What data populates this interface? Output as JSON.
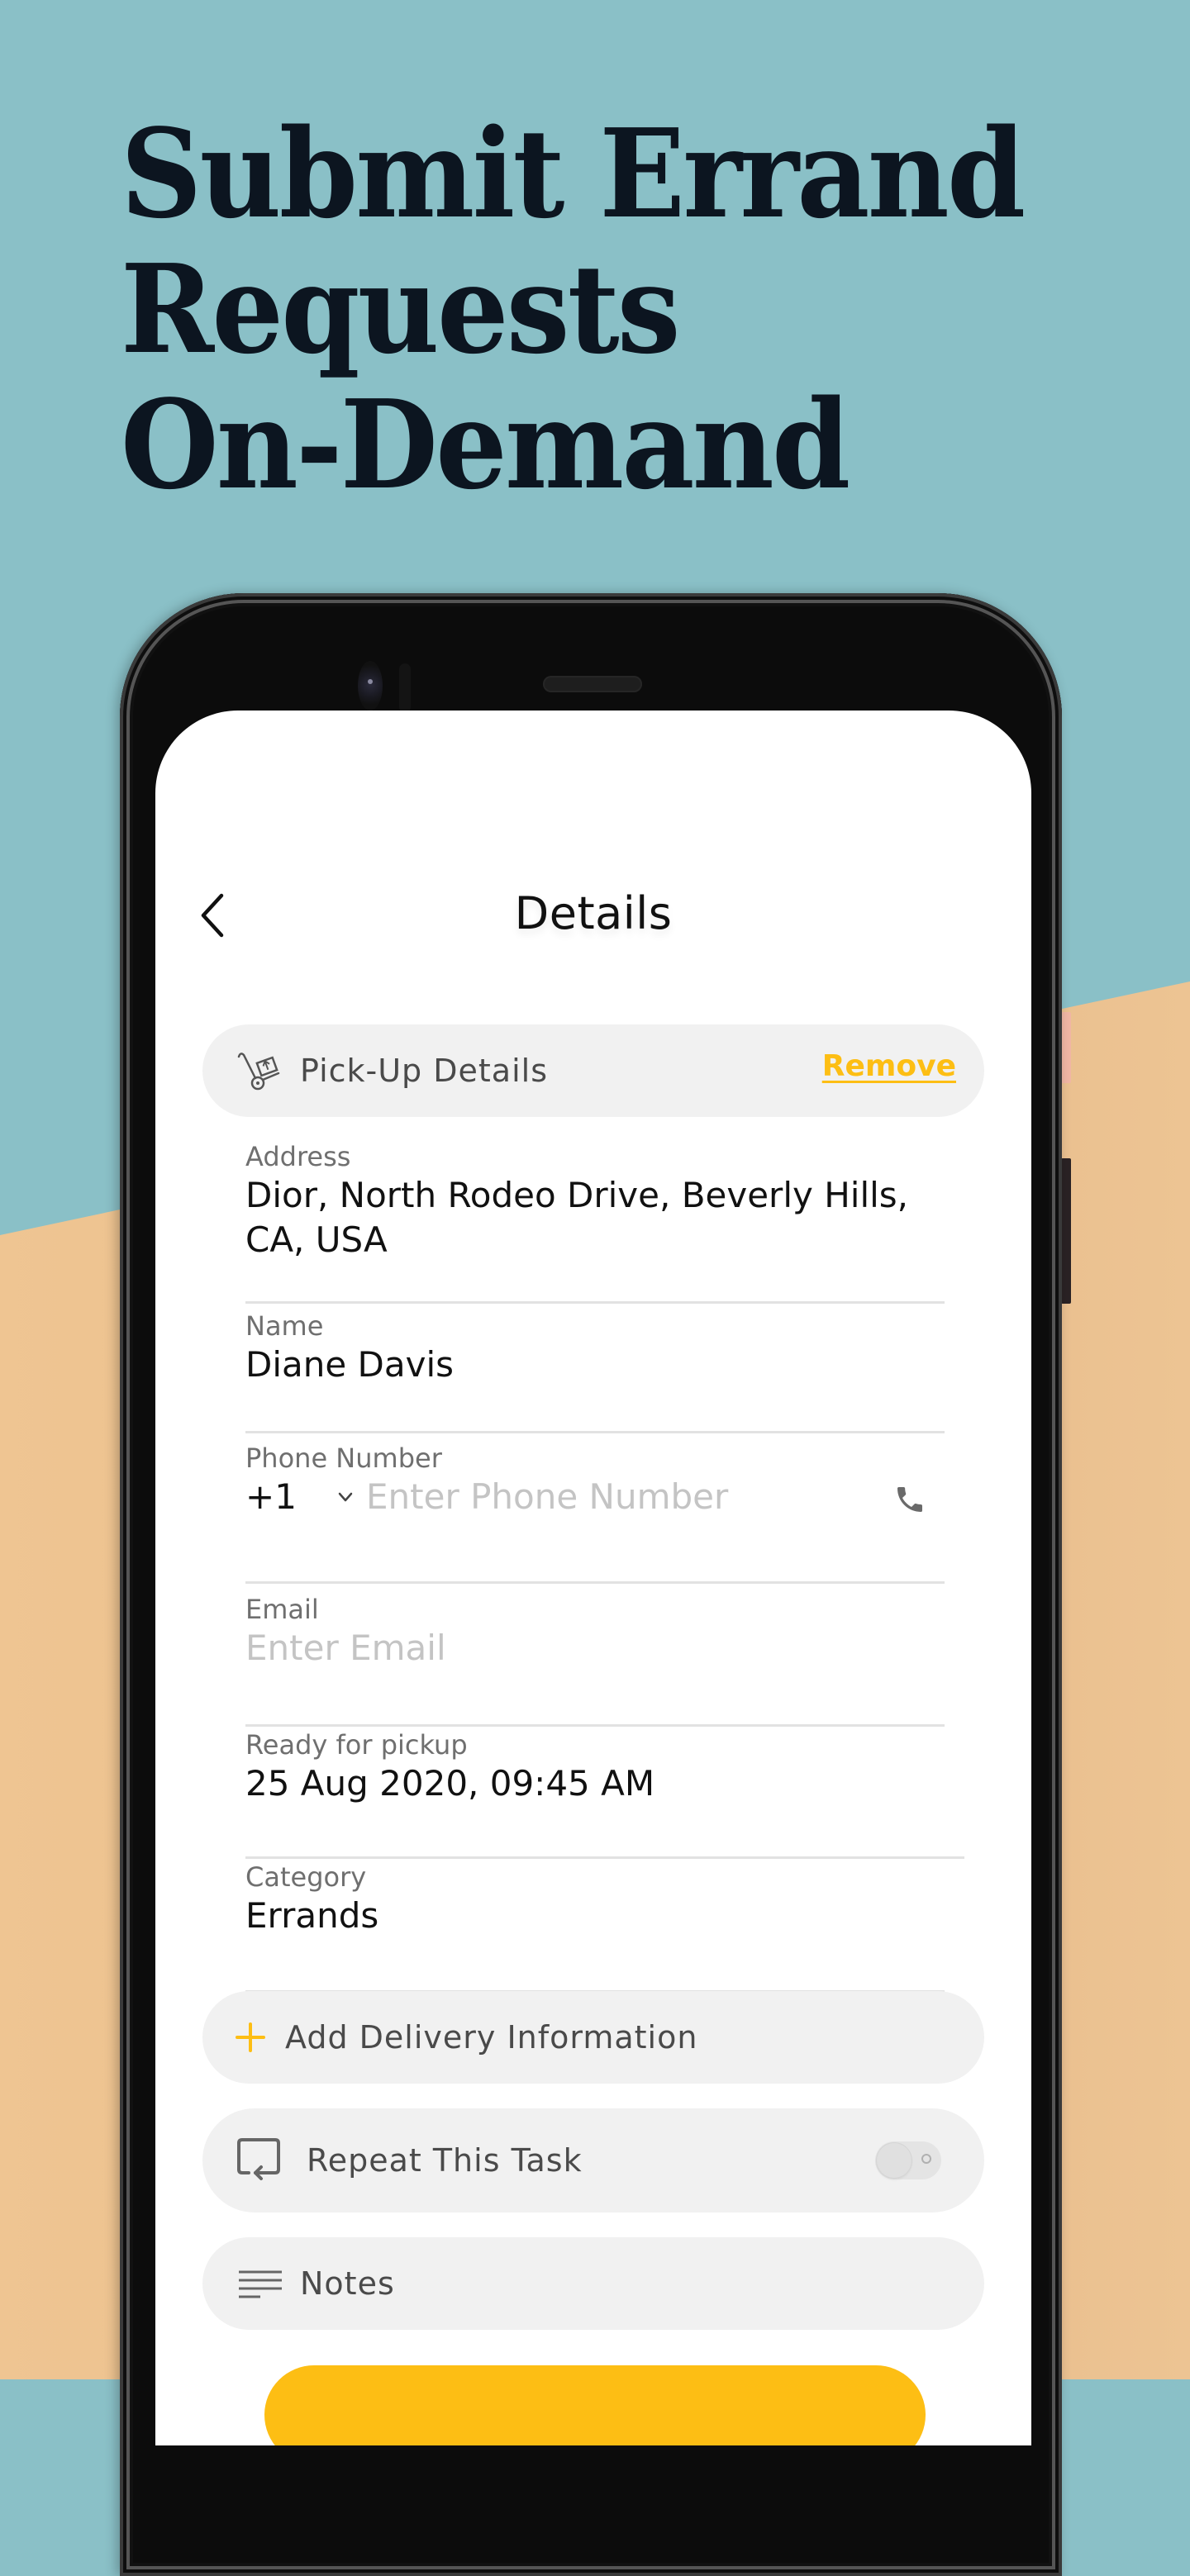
{
  "headline": {
    "lines": [
      "Submit Errand",
      "Requests",
      "On-Demand"
    ]
  },
  "colors": {
    "background_top": "#8ac0c7",
    "background_bottom": "#e8be8c",
    "headline_text": "#0c1520",
    "accent_yellow": "#fdbe14",
    "pill_background": "#f1f1f1"
  },
  "app": {
    "header": {
      "back_icon": "chevron-left-icon",
      "title": "Details"
    },
    "pickup_section": {
      "icon": "hand-truck-icon",
      "label": "Pick-Up Details",
      "remove_label": "Remove"
    },
    "fields": {
      "address": {
        "label": "Address",
        "value": "Dior, North Rodeo Drive, Beverly Hills, CA, USA"
      },
      "name": {
        "label": "Name",
        "value": "Diane Davis"
      },
      "phone": {
        "label": "Phone Number",
        "country_code": "+1",
        "placeholder": "Enter Phone Number",
        "value": "",
        "icon": "phone-icon"
      },
      "email": {
        "label": "Email",
        "placeholder": "Enter Email",
        "value": ""
      },
      "ready_for_pickup": {
        "label": "Ready for pickup",
        "value": "25 Aug 2020, 09:45 AM"
      },
      "category": {
        "label": "Category",
        "value": "Errands"
      }
    },
    "actions": {
      "add_delivery": {
        "icon": "plus-icon",
        "label": "Add Delivery Information"
      },
      "repeat_task": {
        "icon": "repeat-icon",
        "label": "Repeat This Task",
        "toggle_on": false
      },
      "notes": {
        "icon": "notes-lines-icon",
        "label": "Notes"
      }
    }
  }
}
